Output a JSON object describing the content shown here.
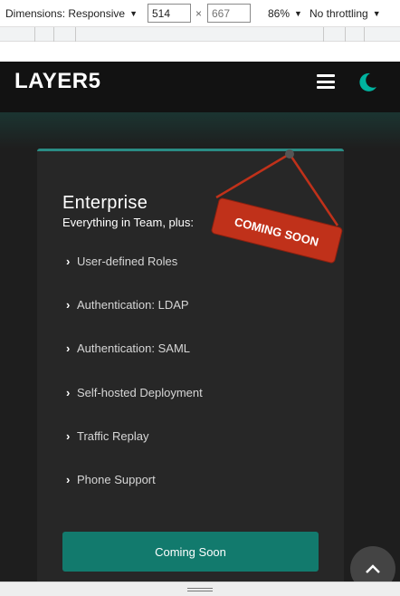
{
  "devtools": {
    "dimensions_label": "Dimensions: Responsive",
    "width_value": "514",
    "height_placeholder": "667",
    "times_symbol": "×",
    "zoom": "86%",
    "throttling": "No throttling",
    "caret_icon": "triangle-down"
  },
  "navbar": {
    "logo_text": "LAYER5",
    "menu_icon": "hamburger-icon",
    "theme_icon": "moon-icon"
  },
  "plan": {
    "title": "Enterprise",
    "subtitle": "Everything in Team, plus:",
    "badge": "COMING SOON",
    "features": [
      "User-defined Roles",
      "Authentication: LDAP",
      "Authentication: SAML",
      "Self-hosted Deployment",
      "Traffic Replay",
      "Phone Support"
    ],
    "cta_label": "Coming Soon"
  },
  "colors": {
    "accent": "#00b39f",
    "button": "#127a6d",
    "badge": "#c0311a",
    "card": "#272727",
    "background": "#1e1e1e"
  }
}
